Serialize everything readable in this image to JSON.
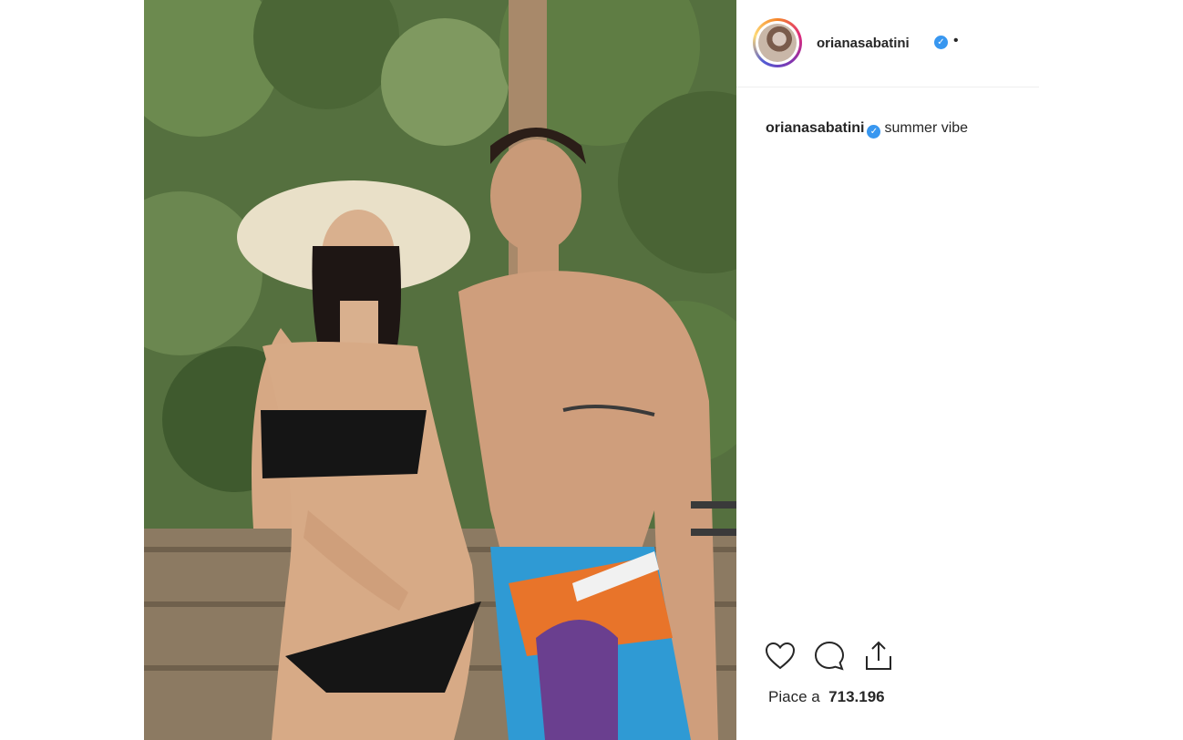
{
  "post": {
    "username": "orianasabatini",
    "verified": true,
    "separator": "•",
    "caption": {
      "username": "orianasabatini",
      "text": "summer vibe"
    },
    "likes": {
      "label": "Piace a",
      "count": "713.196"
    }
  },
  "icons": {
    "like": "heart-icon",
    "comment": "comment-icon",
    "share": "share-icon",
    "verified": "verified-badge-icon"
  },
  "colors": {
    "verified": "#3897f0",
    "text": "#262626"
  }
}
